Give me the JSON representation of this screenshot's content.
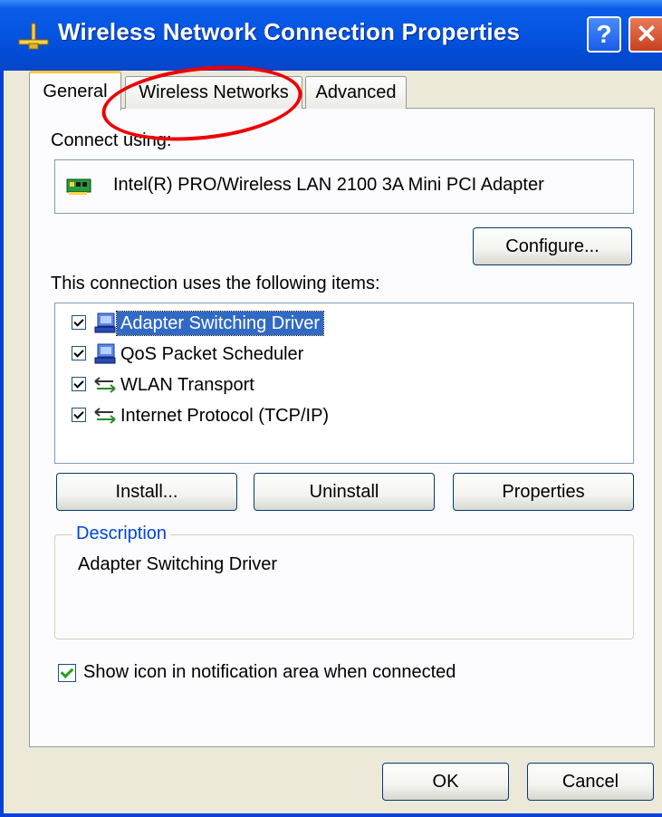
{
  "window": {
    "title": "Wireless Network Connection Properties",
    "help_glyph": "?",
    "close_glyph": "✕",
    "title_icon": "network-connection-icon"
  },
  "tabs": [
    {
      "label": "General",
      "selected": true
    },
    {
      "label": "Wireless Networks",
      "selected": false
    },
    {
      "label": "Advanced",
      "selected": false
    }
  ],
  "general": {
    "connect_using_label": "Connect using:",
    "adapter_name": "Intel(R) PRO/Wireless LAN 2100 3A Mini PCI Adapter",
    "adapter_icon": "network-card-icon",
    "configure_button": "Configure...",
    "items_label": "This connection uses the following items:",
    "items": [
      {
        "label": "Adapter Switching Driver",
        "checked": true,
        "selected": true,
        "icon": "computer-network-icon"
      },
      {
        "label": "QoS Packet Scheduler",
        "checked": true,
        "selected": false,
        "icon": "computer-network-icon"
      },
      {
        "label": "WLAN Transport",
        "checked": true,
        "selected": false,
        "icon": "protocol-icon"
      },
      {
        "label": "Internet Protocol (TCP/IP)",
        "checked": true,
        "selected": false,
        "icon": "protocol-icon"
      }
    ],
    "install_button": "Install...",
    "uninstall_button": "Uninstall",
    "properties_button": "Properties",
    "description_legend": "Description",
    "description_text": "Adapter Switching Driver",
    "show_icon_label": "Show icon in notification area when connected",
    "show_icon_checked": true
  },
  "footer": {
    "ok_button": "OK",
    "cancel_button": "Cancel"
  },
  "colors": {
    "titlebar": "#0454e0",
    "selection": "#316ac5",
    "annotation": "#ee0000",
    "legend": "#0046d5"
  }
}
